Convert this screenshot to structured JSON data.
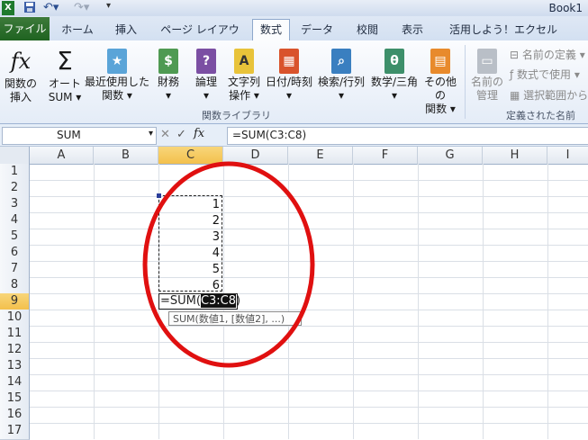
{
  "window": {
    "title": "Book1"
  },
  "ribbon_tabs": [
    "ファイル",
    "ホーム",
    "挿入",
    "ページ レイアウト",
    "数式",
    "データ",
    "校閲",
    "表示",
    "活用しよう！エクセル"
  ],
  "active_tab": "数式",
  "ribbon": {
    "insert_function": [
      "関数の",
      "挿入"
    ],
    "autosum": [
      "オート",
      "SUM ▾"
    ],
    "recent": [
      "最近使用した",
      "関数 ▾"
    ],
    "financial": "財務",
    "logical": "論理",
    "text": [
      "文字列",
      "操作 ▾"
    ],
    "datetime": "日付/時刻",
    "lookup": "検索/行列",
    "math": "数学/三角",
    "more": [
      "その他の",
      "関数 ▾"
    ],
    "library_label": "関数ライブラリ",
    "name_manager": [
      "名前の",
      "管理"
    ],
    "define_name": "名前の定義 ▾",
    "use_in_formula": "数式で使用 ▾",
    "create_from_selection": "選択範囲から",
    "defined_names_label": "定義された名前"
  },
  "formula_bar": {
    "name_box": "SUM",
    "fx": "fx",
    "formula": "=SUM(C3:C8)"
  },
  "columns": [
    "A",
    "B",
    "C",
    "D",
    "E",
    "F",
    "G",
    "H",
    "I"
  ],
  "rows": [
    "1",
    "2",
    "3",
    "4",
    "5",
    "6",
    "7",
    "8",
    "9",
    "10",
    "11",
    "12",
    "13",
    "14",
    "15",
    "16",
    "17"
  ],
  "cells": {
    "C3": "1",
    "C4": "2",
    "C5": "3",
    "C6": "4",
    "C7": "5",
    "C8": "6"
  },
  "editing_cell": {
    "prefix": "=SUM(",
    "ref": "C3:C8",
    "suffix": ")"
  },
  "tooltip": "SUM(数値1, [数値2], ...)",
  "colors": {
    "file_tab": "#1f6321",
    "annotation_circle": "#e01010",
    "selected_header": "#f3c04c"
  }
}
